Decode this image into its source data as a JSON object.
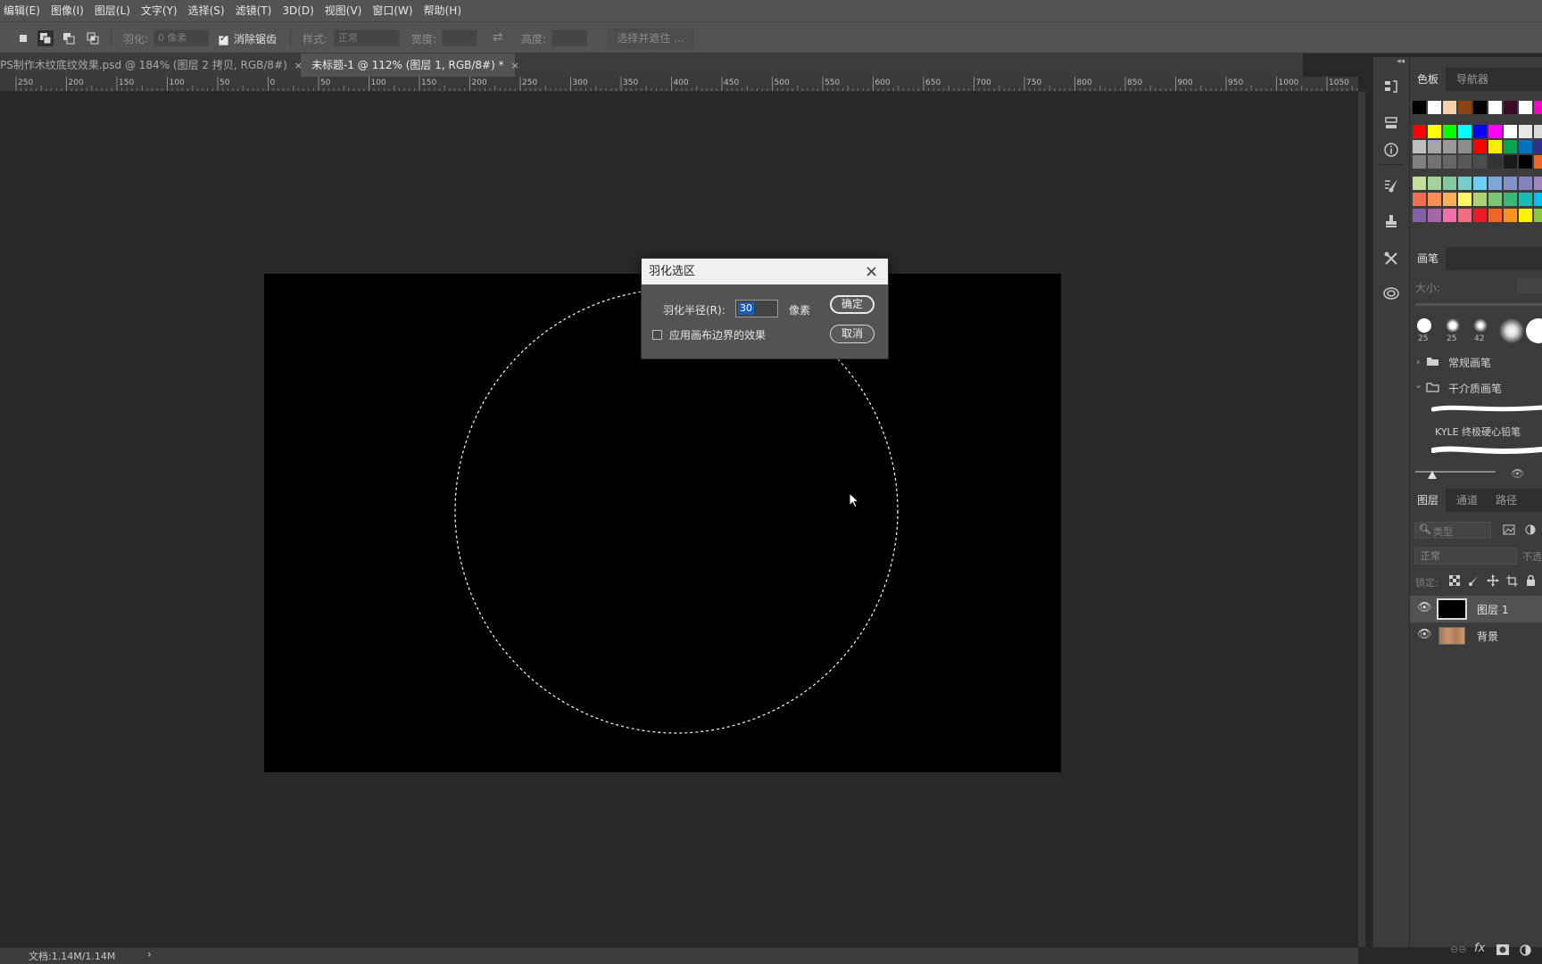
{
  "menu": [
    "编辑(E)",
    "图像(I)",
    "图层(L)",
    "文字(Y)",
    "选择(S)",
    "滤镜(T)",
    "3D(D)",
    "视图(V)",
    "窗口(W)",
    "帮助(H)"
  ],
  "options": {
    "feather_label": "羽化:",
    "feather_value": "0 像素",
    "antialias_label": "消除锯齿",
    "style_label": "样式:",
    "style_value": "正常",
    "width_label": "宽度:",
    "height_label": "高度:",
    "select_mask_button": "选择并遮住 ..."
  },
  "tabs": [
    {
      "label": "PS制作木纹底纹效果.psd @ 184% (图层 2 拷贝, RGB/8#)",
      "close": "×",
      "active": false
    },
    {
      "label": "未标题-1 @ 112% (图层 1, RGB/8#) *",
      "close": "×",
      "active": true
    }
  ],
  "ruler_labels": [
    "250",
    "200",
    "150",
    "100",
    "50",
    "0",
    "50",
    "100",
    "150",
    "200",
    "250",
    "300",
    "350",
    "400",
    "450",
    "500",
    "550",
    "600",
    "650",
    "700",
    "750",
    "800",
    "850",
    "900",
    "950",
    "1000",
    "1050"
  ],
  "dialog": {
    "title": "羽化选区",
    "close_icon": "×",
    "radius_label": "羽化半径(R):",
    "radius_value": "30",
    "unit": "像素",
    "ok": "确定",
    "cancel": "取消",
    "apply_canvas_label": "应用画布边界的效果",
    "apply_canvas_checked": false
  },
  "right_panel": {
    "swatch_tabs": [
      "色板",
      "导航器"
    ],
    "brush_tab": "画笔",
    "brush_size_label": "大小:",
    "brush_sizes": [
      "25",
      "25",
      "42"
    ],
    "brush_groups": [
      "常规画笔",
      "干介质画笔"
    ],
    "brush_item": "KYLE 终极硬心铅笔",
    "layer_tabs": [
      "图层",
      "通道",
      "路径"
    ],
    "layer_search_placeholder": "类型",
    "blend_mode": "正常",
    "opacity_label": "不透",
    "lock_label": "锁定:",
    "layers": [
      {
        "name": "图层 1",
        "selected": true
      },
      {
        "name": "背景",
        "selected": false
      }
    ]
  },
  "status": {
    "doc_info": "文档:1.14M/1.14M",
    "arrow": "›"
  },
  "colors": {
    "accent_selection": "#1a5fb4",
    "ui_bg": "#535353",
    "canvas": "#000000"
  }
}
